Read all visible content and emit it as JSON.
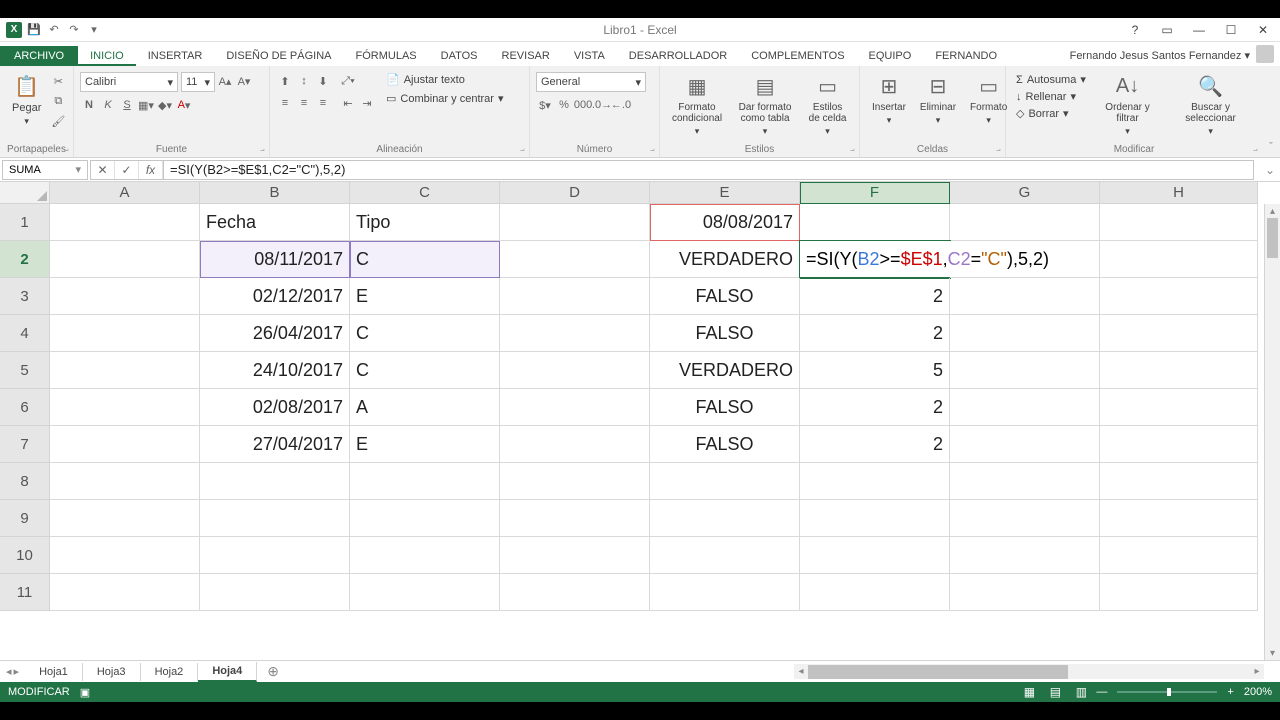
{
  "titlebar": {
    "title": "Libro1 - Excel"
  },
  "ribbon": {
    "file": "ARCHIVO",
    "tabs": [
      "INICIO",
      "INSERTAR",
      "DISEÑO DE PÁGINA",
      "FÓRMULAS",
      "DATOS",
      "REVISAR",
      "VISTA",
      "DESARROLLADOR",
      "COMPLEMENTOS",
      "EQUIPO",
      "Fernando"
    ],
    "user": "Fernando Jesus Santos Fernandez",
    "clipboard": {
      "paste": "Pegar",
      "group": "Portapapeles"
    },
    "font": {
      "family": "Calibri",
      "size": "11",
      "group": "Fuente"
    },
    "align": {
      "wrap": "Ajustar texto",
      "merge": "Combinar y centrar",
      "group": "Alineación"
    },
    "number": {
      "format": "General",
      "group": "Número"
    },
    "styles": {
      "cond": "Formato condicional",
      "table": "Dar formato como tabla",
      "cell": "Estilos de celda",
      "group": "Estilos"
    },
    "cells": {
      "insert": "Insertar",
      "delete": "Eliminar",
      "format": "Formato",
      "group": "Celdas"
    },
    "editing": {
      "sum": "Autosuma",
      "fill": "Rellenar",
      "clear": "Borrar",
      "sort": "Ordenar y filtrar",
      "find": "Buscar y seleccionar",
      "group": "Modificar"
    }
  },
  "namebox": "SUMA",
  "formula": "=SI(Y(B2>=$E$1,C2=\"C\"),5,2)",
  "columns": [
    "A",
    "B",
    "C",
    "D",
    "E",
    "F",
    "G",
    "H"
  ],
  "grid": {
    "r1": {
      "B": "Fecha",
      "C": "Tipo",
      "E": "08/08/2017"
    },
    "r2": {
      "B": "08/11/2017",
      "C": "C",
      "E": "VERDADERO"
    },
    "r3": {
      "B": "02/12/2017",
      "C": "E",
      "E": "FALSO",
      "F": "2"
    },
    "r4": {
      "B": "26/04/2017",
      "C": "C",
      "E": "FALSO",
      "F": "2"
    },
    "r5": {
      "B": "24/10/2017",
      "C": "C",
      "E": "VERDADERO",
      "F": "5"
    },
    "r6": {
      "B": "02/08/2017",
      "C": "A",
      "E": "FALSO",
      "F": "2"
    },
    "r7": {
      "B": "27/04/2017",
      "C": "E",
      "E": "FALSO",
      "F": "2"
    }
  },
  "formula_edit": {
    "pre": "=SI(Y(",
    "b2": "B2",
    "gte": ">=",
    "e1": "$E$1",
    "comma1": ",",
    "c2": "C2",
    "eq": "=",
    "str": "\"C\"",
    "post": "),5,2)"
  },
  "sheets": [
    "Hoja1",
    "Hoja3",
    "Hoja2",
    "Hoja4"
  ],
  "status": {
    "mode": "MODIFICAR",
    "zoom": "200%"
  }
}
